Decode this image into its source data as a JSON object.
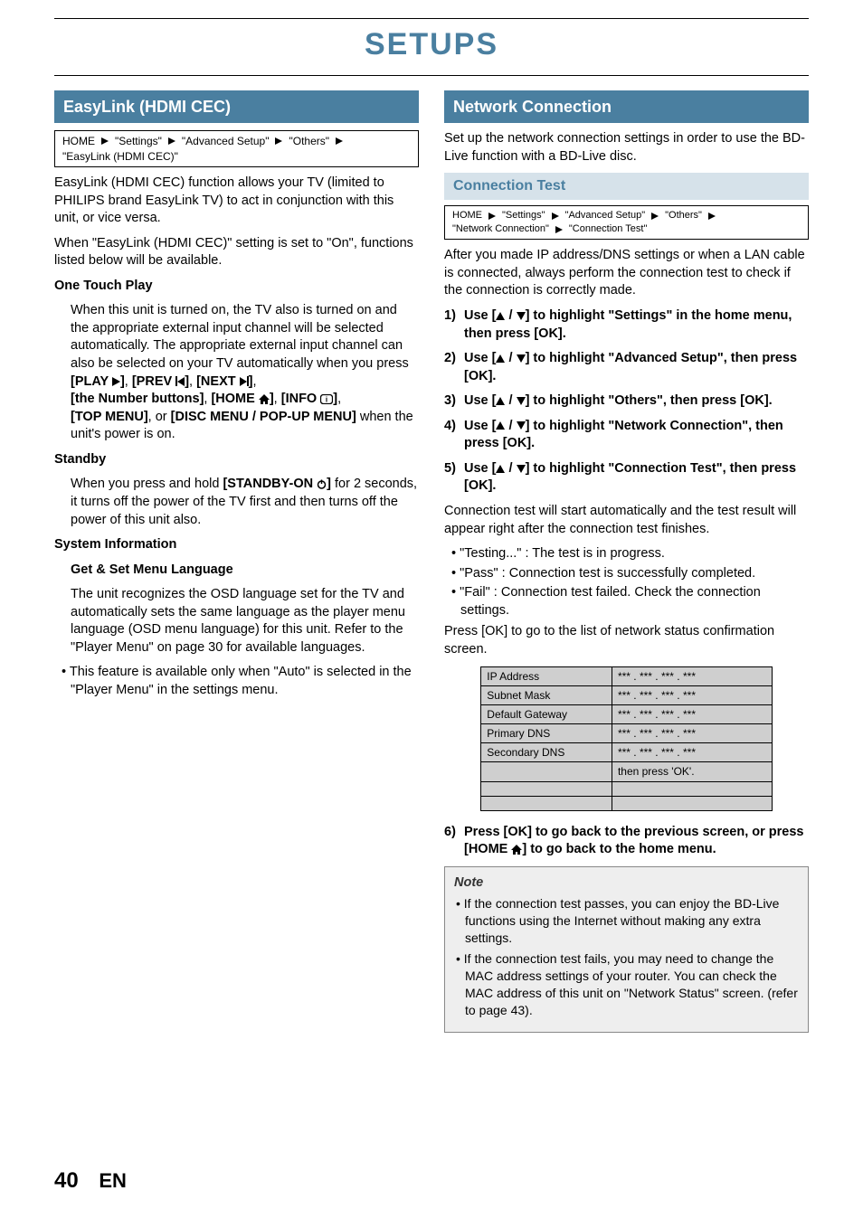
{
  "page_title": "SETUPS",
  "page_number": "40",
  "page_lang": "EN",
  "left": {
    "section_title": "EasyLink (HDMI CEC)",
    "path": [
      "HOME",
      "\"Settings\"",
      "\"Advanced Setup\"",
      "\"Others\"",
      "\"EasyLink (HDMI CEC)\""
    ],
    "intro1": "EasyLink (HDMI CEC) function allows your TV (limited to PHILIPS brand EasyLink TV) to act in conjunction with this unit, or vice versa.",
    "intro2": "When \"EasyLink (HDMI CEC)\" setting is set to \"On\", functions listed below will be available.",
    "h_onetouch": "One Touch Play",
    "onetouch_p1": "When this unit is turned on, the TV also is turned on and the appropriate external input channel will be selected automatically. The appropriate external input channel can also be selected on your TV automatically when you press ",
    "btn_play": "[PLAY ",
    "btn_prev": "[PREV ",
    "btn_next": "[NEXT ",
    "btn_close": "]",
    "btn_number": "[the Number buttons]",
    "btn_home": "[HOME ",
    "btn_info": "[INFO ",
    "btn_top": "[TOP MENU]",
    "btn_disc": "[DISC MENU / POP-UP MENU]",
    "onetouch_p2_tail": " when the unit's power is on.",
    "h_standby": "Standby",
    "standby_p_lead": "When you press and hold ",
    "btn_standby": "[STANDBY-ON ",
    "standby_p_tail": " for 2 seconds, it turns off the power of the TV first and then turns off the power of this unit also.",
    "h_sysinfo": "System Information",
    "h_getset": "Get & Set Menu Language",
    "sysinfo_p": "The unit recognizes the OSD language set for the TV and automatically sets the same language as the player menu language (OSD menu language) for this unit. Refer to the \"Player Menu\" on page 30 for available languages.",
    "bullet_auto": "This feature is available only when \"Auto\" is selected in the \"Player Menu\" in the settings menu."
  },
  "right": {
    "section_title": "Network Connection",
    "intro": "Set up the network connection settings in order to use the BD-Live function with a BD-Live disc.",
    "sub_conn": "Connection Test",
    "path": [
      "HOME",
      "\"Settings\"",
      "\"Advanced Setup\"",
      "\"Others\"",
      "\"Network Connection\"",
      "\"Connection Test\""
    ],
    "after_ip": "After you made IP address/DNS settings or when a LAN cable is connected, always perform the connection test to check if the connection is correctly made.",
    "steps": [
      "Use [▲ / ▼] to highlight \"Settings\" in the home menu, then press [OK].",
      "Use [▲ / ▼] to highlight \"Advanced Setup\", then press [OK].",
      "Use [▲ / ▼] to highlight \"Others\", then press [OK].",
      "Use [▲ / ▼] to highlight \"Network Connection\", then press [OK].",
      "Use [▲ / ▼] to highlight \"Connection Test\", then press [OK]."
    ],
    "after_steps": "Connection test will start automatically and the test result will appear right after the connection test finishes.",
    "results": [
      "\"Testing...\" : The test is in progress.",
      "\"Pass\" : Connection test is successfully completed.",
      "\"Fail\" : Connection test failed. Check the connection settings."
    ],
    "press_ok": " Press [OK] to go to the list of network status confirmation screen.",
    "table": [
      {
        "k": "IP Address",
        "v": "*** . *** . *** . ***"
      },
      {
        "k": "Subnet Mask",
        "v": "*** . *** . *** . ***"
      },
      {
        "k": "Default Gateway",
        "v": "*** . *** . *** . ***"
      },
      {
        "k": "Primary DNS",
        "v": "*** . *** . *** . ***"
      },
      {
        "k": "Secondary DNS",
        "v": "*** . *** . *** . ***"
      },
      {
        "k": "",
        "v": "then press 'OK'."
      },
      {
        "k": "",
        "v": ""
      },
      {
        "k": "",
        "v": ""
      }
    ],
    "step6_a": "Press [OK] to go back to the previous screen, or press [HOME ",
    "step6_b": "] to go back to the home menu.",
    "note_title": "Note",
    "notes": [
      "If the connection test passes, you can enjoy the BD-Live functions using the Internet without making any extra settings.",
      "If the connection test fails, you may need to change the MAC address settings of your router. You can check the MAC address of this unit on \"Network Status\" screen. (refer to page 43)."
    ]
  }
}
